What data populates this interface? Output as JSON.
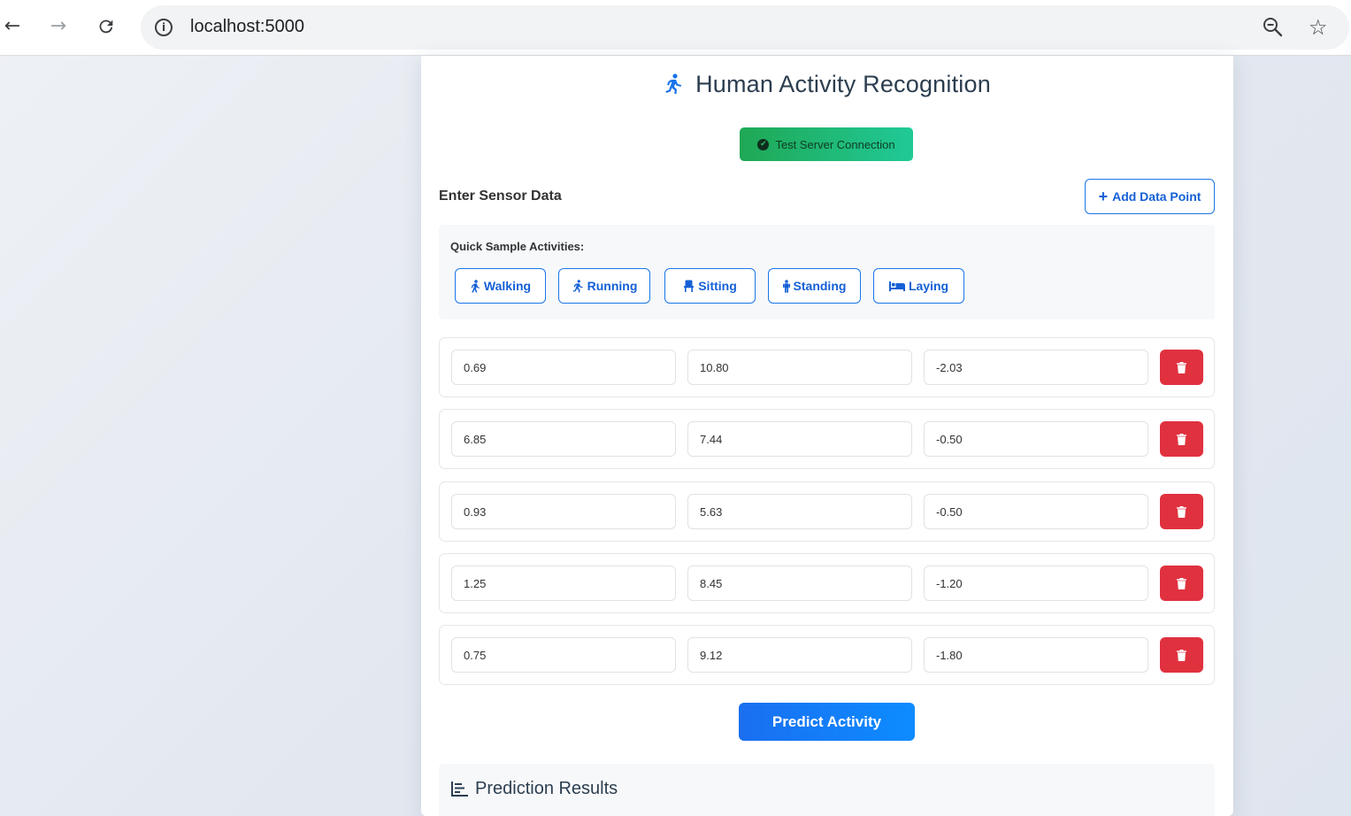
{
  "browser": {
    "url": "localhost:5000"
  },
  "app": {
    "title": "Human Activity Recognition",
    "test_button": "Test Server Connection",
    "section_label": "Enter Sensor Data",
    "add_button": "Add Data Point",
    "samples_label": "Quick Sample Activities:",
    "samples": [
      "Walking",
      "Running",
      "Sitting",
      "Standing",
      "Laying"
    ],
    "rows": [
      [
        "0.69",
        "10.80",
        "-2.03"
      ],
      [
        "6.85",
        "7.44",
        "-0.50"
      ],
      [
        "0.93",
        "5.63",
        "-0.50"
      ],
      [
        "1.25",
        "8.45",
        "-1.20"
      ],
      [
        "0.75",
        "9.12",
        "-1.80"
      ]
    ],
    "predict_button": "Predict Activity",
    "results_title": "Prediction Results"
  },
  "colors": {
    "accent": "#1976e8",
    "success": "#20c997",
    "danger": "#e0313f",
    "title": "#2c3e50"
  }
}
